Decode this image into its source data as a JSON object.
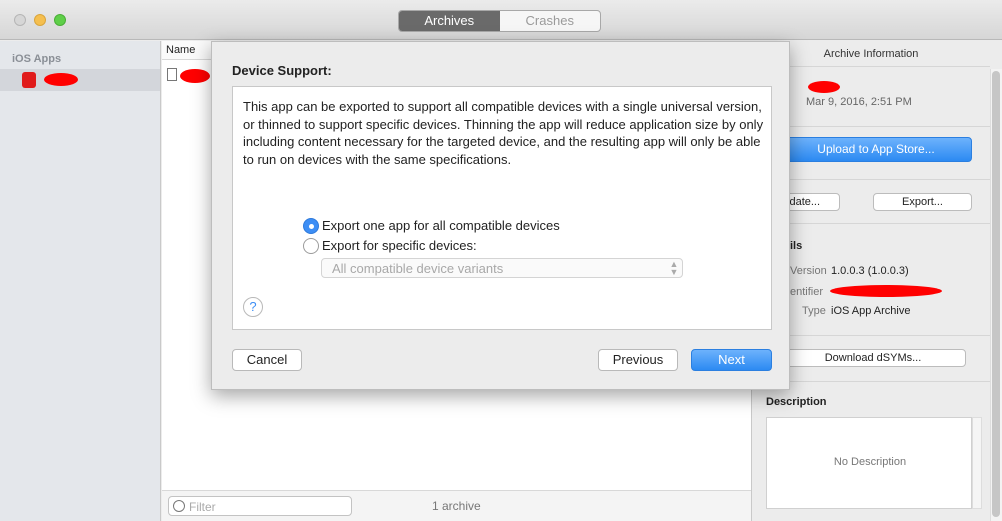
{
  "window": {
    "tabs": [
      {
        "label": "Archives",
        "active": true
      },
      {
        "label": "Crashes",
        "active": false
      }
    ]
  },
  "sidebar": {
    "header": "iOS Apps"
  },
  "list": {
    "column_header": "Name",
    "filter_placeholder": "Filter",
    "archive_count": "1 archive"
  },
  "inspector": {
    "title": "Archive Information",
    "archive_date": "Mar 9, 2016, 2:51 PM",
    "upload_button": "Upload to App Store...",
    "validate_button": "Validate...",
    "export_button": "Export...",
    "details_heading": "ils",
    "version_label": "Version",
    "version_value": "1.0.0.3 (1.0.0.3)",
    "identifier_label": "entifier",
    "type_label": "Type",
    "type_value": "iOS App Archive",
    "download_dsyms_button": "Download dSYMs...",
    "description_heading": "Description",
    "description_placeholder": "No Description"
  },
  "dialog": {
    "title": "Device Support:",
    "description": "This app can be exported to support all compatible devices with a single universal version, or thinned to support specific devices. Thinning the app will reduce application size by only including content necessary for the targeted device, and the resulting app will only be able to run on devices with the same specifications.",
    "options": [
      {
        "label": "Export one app for all compatible devices",
        "selected": true
      },
      {
        "label": "Export for specific devices:",
        "selected": false
      }
    ],
    "variant_select_value": "All compatible device variants",
    "help_symbol": "?",
    "cancel_button": "Cancel",
    "previous_button": "Previous",
    "next_button": "Next"
  },
  "colors": {
    "accent_blue": "#3d8ef5",
    "redaction": "#ff0000"
  }
}
